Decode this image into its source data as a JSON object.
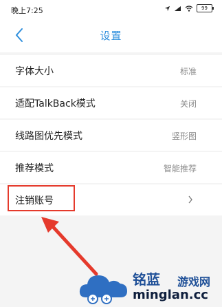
{
  "status_bar": {
    "time": "晚上7:25",
    "battery": "99"
  },
  "header": {
    "title": "设置"
  },
  "settings": [
    {
      "label": "字体大小",
      "value": "标准"
    },
    {
      "label": "适配TalkBack模式",
      "value": "关闭"
    },
    {
      "label": "线路图优先模式",
      "value": "竖形图"
    },
    {
      "label": "推荐模式",
      "value": "智能推荐"
    },
    {
      "label": "注销账号",
      "value": ""
    }
  ],
  "watermark": {
    "brand_cn": "铭蓝",
    "brand_cn2": "游戏网",
    "brand_en": "minglan.cc"
  },
  "colors": {
    "accent": "#2f8fdd",
    "highlight": "#e53a2c"
  }
}
